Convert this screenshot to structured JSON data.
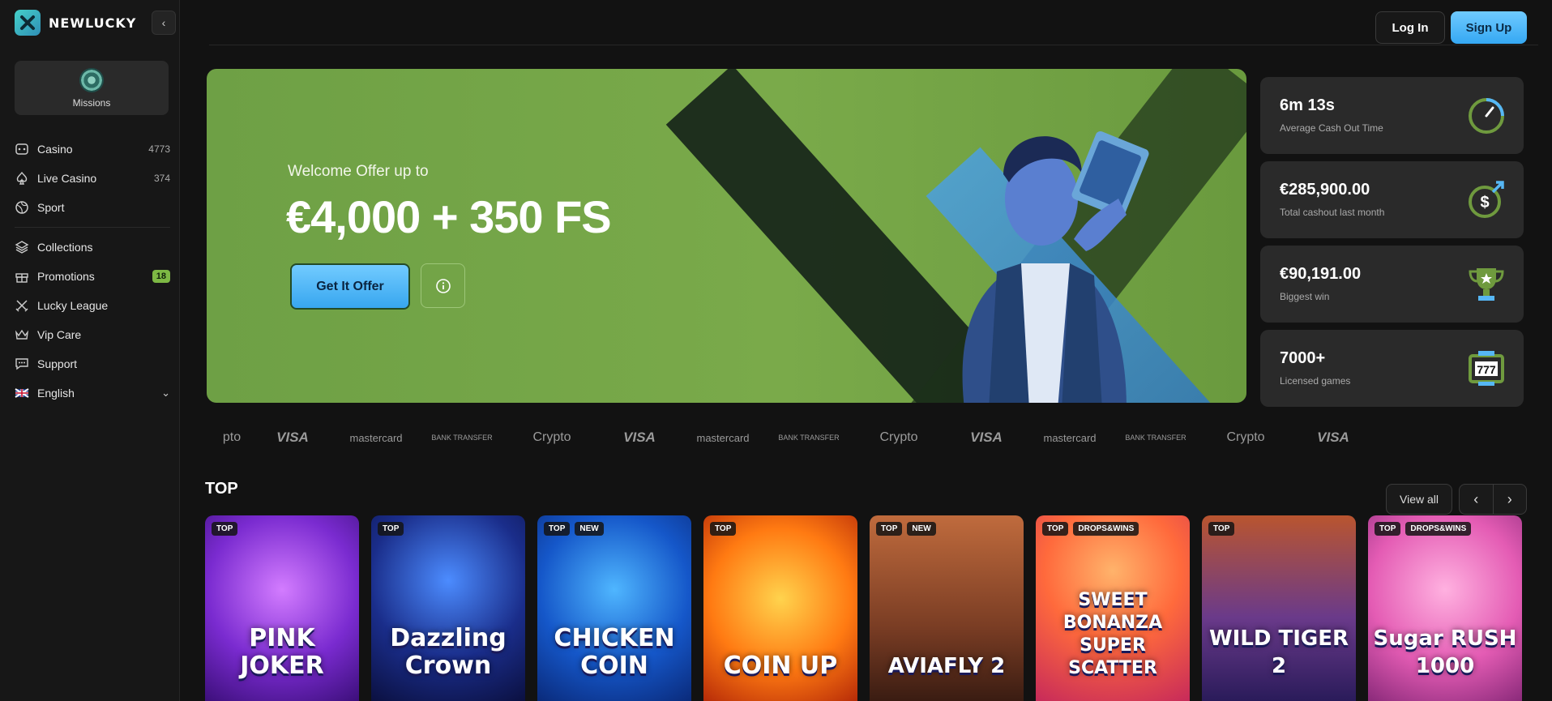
{
  "brand": {
    "name": "NEWLUCKY"
  },
  "sidebar": {
    "missions_label": "Missions",
    "items": [
      {
        "label": "Casino",
        "count": "4773",
        "icon": "casino-icon"
      },
      {
        "label": "Live Casino",
        "count": "374",
        "icon": "spade-icon"
      },
      {
        "label": "Sport",
        "count": "",
        "icon": "ball-icon"
      },
      {
        "label": "Collections",
        "count": "",
        "icon": "layers-icon"
      },
      {
        "label": "Promotions",
        "badge": "18",
        "icon": "gift-icon"
      },
      {
        "label": "Lucky League",
        "count": "",
        "icon": "swords-icon"
      },
      {
        "label": "Vip Care",
        "count": "",
        "icon": "crown-icon"
      },
      {
        "label": "Support",
        "count": "",
        "icon": "chat-icon"
      },
      {
        "label": "English",
        "count": "",
        "icon": "uk-flag-icon"
      }
    ]
  },
  "header": {
    "login": "Log In",
    "signup": "Sign Up"
  },
  "hero": {
    "subtitle": "Welcome Offer up to",
    "title": "€4,000 + 350 FS",
    "cta": "Get It Offer"
  },
  "stats": [
    {
      "value": "6m 13s",
      "label": "Average Cash Out Time",
      "icon": "speedometer-icon"
    },
    {
      "value": "€285,900.00",
      "label": "Total cashout last month",
      "icon": "dollar-arrow-icon"
    },
    {
      "value": "€90,191.00",
      "label": "Biggest win",
      "icon": "trophy-icon"
    },
    {
      "value": "7000+",
      "label": "Licensed games",
      "icon": "slot-777-icon"
    }
  ],
  "payments": [
    "pto",
    "VISA",
    "mastercard",
    "BANK TRANSFER",
    "Crypto",
    "VISA",
    "mastercard",
    "BANK TRANSFER",
    "Crypto",
    "VISA",
    "mastercard",
    "BANK TRANSFER",
    "Crypto",
    "VISA"
  ],
  "top": {
    "title": "TOP",
    "view_all": "View all",
    "games": [
      {
        "name": "PINK JOKER",
        "tags": [
          "TOP"
        ]
      },
      {
        "name": "Dazzling Crown",
        "tags": [
          "TOP"
        ]
      },
      {
        "name": "CHICKEN COIN",
        "tags": [
          "TOP",
          "NEW"
        ]
      },
      {
        "name": "COIN UP",
        "tags": [
          "TOP"
        ]
      },
      {
        "name": "AVIAFLY 2",
        "tags": [
          "TOP",
          "NEW"
        ]
      },
      {
        "name": "SWEET BONANZA SUPER SCATTER",
        "tags": [
          "TOP",
          "DROPS&WINS"
        ]
      },
      {
        "name": "WILD TIGER 2",
        "tags": [
          "TOP"
        ]
      },
      {
        "name": "Sugar RUSH 1000",
        "tags": [
          "TOP",
          "DROPS&WINS"
        ]
      }
    ]
  },
  "colors": {
    "accent_blue": "#45abf2",
    "hero_green": "#77a748",
    "badge_green": "#7db844",
    "panel": "#2a2a2a"
  }
}
